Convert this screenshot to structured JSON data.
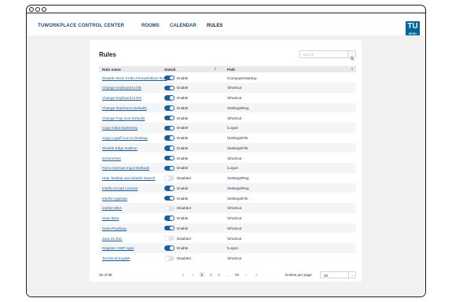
{
  "nav": {
    "brand": "TUWORKPLACE CONTROL CENTER",
    "links": [
      "ROOMS",
      "CALENDAR",
      "RULES"
    ],
    "active": "RULES",
    "logo_main": "TU",
    "logo_sub": "WIEN",
    "logo_color": "#006699"
  },
  "page": {
    "title": "Rules",
    "search_placeholder": "Search"
  },
  "table": {
    "columns": {
      "name": "Rule name",
      "status": "Status",
      "path": "Path"
    },
    "rows": [
      {
        "name": "Disable Heinz Krobo Firewall Block Rule",
        "enabled": true,
        "status": "Enable",
        "path": "\\Computer\\Startup"
      },
      {
        "name": "Change Keyboard to DE",
        "enabled": true,
        "status": "Enable",
        "path": "\\Shortcut"
      },
      {
        "name": "Change Keyboard to EN",
        "enabled": true,
        "status": "Enable",
        "path": "\\Shortcut"
      },
      {
        "name": "Change Startmenu Defaults",
        "enabled": true,
        "status": "Enable",
        "path": "\\Settings\\Reg"
      },
      {
        "name": "Change Tray Icon Defaults",
        "enabled": true,
        "status": "Enable",
        "path": "\\Shortcut"
      },
      {
        "name": "Copy Initial Startmenu",
        "enabled": true,
        "status": "Enable",
        "path": "\\Logon"
      },
      {
        "name": "Copy Logoff Icon to Desktop",
        "enabled": true,
        "status": "Enable",
        "path": "\\Settings\\File"
      },
      {
        "name": "Disable Edge 2ndRun",
        "enabled": true,
        "status": "Enable",
        "path": "\\Settings\\File"
      },
      {
        "name": "EChemTest",
        "enabled": true,
        "status": "Enable",
        "path": "\\Shortcut"
      },
      {
        "name": "Force German Input Methods",
        "enabled": true,
        "status": "Enable",
        "path": "\\Logon"
      },
      {
        "name": "Hide Taskbar and disable Search",
        "enabled": false,
        "status": "Disabled",
        "path": "\\Settings\\Reg"
      },
      {
        "name": "IntelliJ Accept License",
        "enabled": true,
        "status": "Enable",
        "path": "\\Settings\\Reg"
      },
      {
        "name": "IntelliJ AppData",
        "enabled": true,
        "status": "Enable",
        "path": "\\Settings\\File"
      },
      {
        "name": "IntelliJ IDEA",
        "enabled": false,
        "status": "Disabled",
        "path": "\\Shortcut"
      },
      {
        "name": "iXam Beta",
        "enabled": true,
        "status": "Enable",
        "path": "\\Shortcut"
      },
      {
        "name": "iXam-Pruefung",
        "enabled": true,
        "status": "Enable",
        "path": "\\Shortcut"
      },
      {
        "name": "Java 21 Doc",
        "enabled": false,
        "status": "Disabled",
        "path": "\\Shortcut"
      },
      {
        "name": "Register UWP Apps",
        "enabled": true,
        "status": "Enable",
        "path": "\\Logon"
      },
      {
        "name": "Technical English",
        "enabled": false,
        "status": "Disabled",
        "path": "\\Shortcut"
      }
    ]
  },
  "pagination": {
    "count_text": "20 of 99",
    "first": "«",
    "prev": "‹",
    "pages": [
      "1",
      "2",
      "3",
      "...",
      "99"
    ],
    "next": "›",
    "last": "»",
    "current": "1",
    "per_page_label": "Entries per page",
    "per_page_value": "20"
  },
  "colors": {
    "accent": "#1b5f9c",
    "link": "#1d5b8f",
    "toggle_off": "#e1e4e7"
  }
}
